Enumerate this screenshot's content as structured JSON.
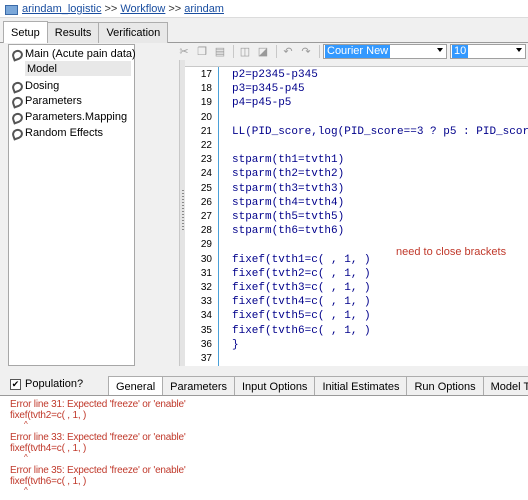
{
  "breadcrumb": {
    "items": [
      "arindam_logistic",
      "Workflow",
      "arindam"
    ],
    "separator": ">>"
  },
  "main_tabs": [
    "Setup",
    "Results",
    "Verification"
  ],
  "tree": {
    "items": [
      {
        "label": "Main (Acute pain data)",
        "icon": "workflow-link-icon"
      },
      {
        "label": "Model",
        "icon": "",
        "selected": true
      },
      {
        "label": "Dosing",
        "icon": "workflow-link-icon"
      },
      {
        "label": "Parameters",
        "icon": "workflow-link-icon"
      },
      {
        "label": "Parameters.Mapping",
        "icon": "workflow-link-icon"
      },
      {
        "label": "Random Effects",
        "icon": "workflow-link-icon"
      }
    ]
  },
  "editor_toolbar": {
    "buttons": [
      "cut-icon",
      "copy-icon",
      "paste-icon",
      "comment-icon",
      "uncomment-icon",
      "undo-icon",
      "redo-icon",
      "find-icon"
    ],
    "font": "Courier New",
    "size": "10"
  },
  "code": {
    "lines": [
      {
        "n": "17",
        "text": "p2=p2345-p345"
      },
      {
        "n": "18",
        "text": "p3=p345-p45"
      },
      {
        "n": "19",
        "text": "p4=p45-p5"
      },
      {
        "n": "20",
        "text": ""
      },
      {
        "n": "21",
        "text": "LL(PID_score,log(PID_score==3 ? p5 : PID_scor"
      },
      {
        "n": "22",
        "text": ""
      },
      {
        "n": "23",
        "text": "stparm(th1=tvth1)"
      },
      {
        "n": "24",
        "text": "stparm(th2=tvth2)"
      },
      {
        "n": "25",
        "text": "stparm(th3=tvth3)"
      },
      {
        "n": "26",
        "text": "stparm(th4=tvth4)"
      },
      {
        "n": "27",
        "text": "stparm(th5=tvth5)"
      },
      {
        "n": "28",
        "text": "stparm(th6=tvth6)"
      },
      {
        "n": "29",
        "text": ""
      },
      {
        "n": "30",
        "text": "fixef(tvth1=c( , 1, )"
      },
      {
        "n": "31",
        "text": "fixef(tvth2=c( , 1, )"
      },
      {
        "n": "32",
        "text": "fixef(tvth3=c( , 1, )"
      },
      {
        "n": "33",
        "text": "fixef(tvth4=c( , 1, )"
      },
      {
        "n": "34",
        "text": "fixef(tvth5=c( , 1, )"
      },
      {
        "n": "35",
        "text": "fixef(tvth6=c( , 1, )"
      },
      {
        "n": "36",
        "text": "}"
      },
      {
        "n": "37",
        "text": ""
      }
    ],
    "annotation": "need to close brackets"
  },
  "population": {
    "label": "Population?",
    "checked": true
  },
  "bottom_tabs": [
    "General",
    "Parameters",
    "Input Options",
    "Initial Estimates",
    "Run Options",
    "Model Text"
  ],
  "errors": [
    {
      "message": "Error line 31: Expected 'freeze' or 'enable'",
      "code": "fixef(tvth2=c( , 1, )"
    },
    {
      "message": "Error line 33: Expected 'freeze' or 'enable'",
      "code": "fixef(tvth4=c( , 1, )"
    },
    {
      "message": "Error line 35: Expected 'freeze' or 'enable'",
      "code": "fixef(tvth6=c( , 1, )"
    }
  ],
  "colors": {
    "link": "#1a4ea0",
    "code_text": "#00008b",
    "error_text": "#c0392b",
    "selection": "#3399ff",
    "gutter_line": "#4aa0d8"
  }
}
